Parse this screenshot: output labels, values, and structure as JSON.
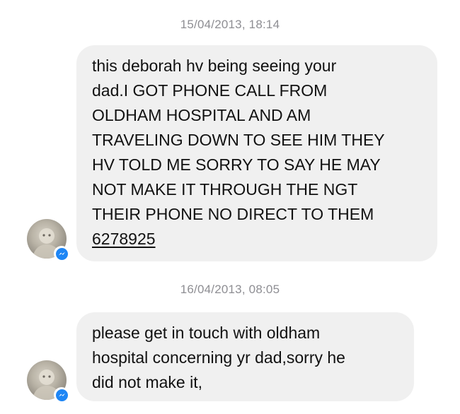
{
  "messages": [
    {
      "timestamp": "15/04/2013, 18:14",
      "lines": [
        "this deborah hv being seeing your",
        "dad.I GOT PHONE CALL FROM",
        "OLDHAM HOSPITAL AND AM",
        "TRAVELING DOWN TO SEE HIM THEY",
        "HV TOLD ME SORRY TO SAY HE MAY",
        "NOT MAKE IT THROUGH THE NGT",
        "THEIR PHONE NO DIRECT TO THEM"
      ],
      "phone_link": "6278925"
    },
    {
      "timestamp": "16/04/2013, 08:05",
      "lines": [
        "please get in touch with oldham",
        "hospital concerning yr dad,sorry he",
        "did not make it,"
      ]
    }
  ],
  "icons": {
    "avatar": "sender-avatar",
    "badge": "messenger-badge-icon"
  },
  "colors": {
    "bubble": "#f0f0f0",
    "timestamp": "#8e8e93",
    "badge": "#1e86f5"
  }
}
